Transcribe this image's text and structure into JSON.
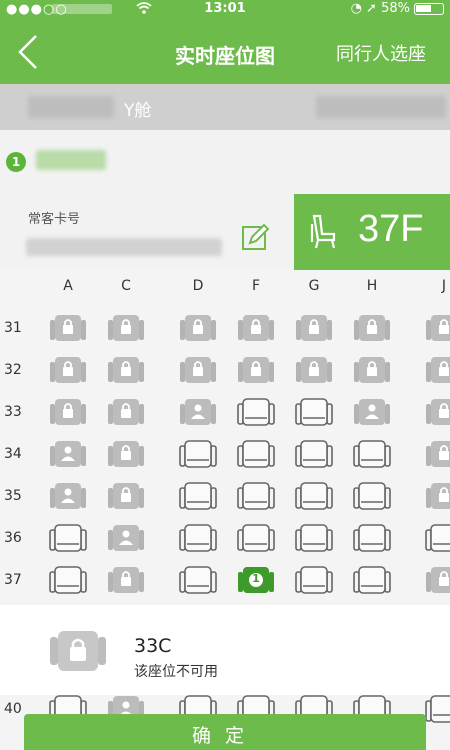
{
  "status_bar": {
    "time": "13:01",
    "battery": "58%"
  },
  "nav": {
    "title": "实时座位图",
    "companion_link": "同行人选座"
  },
  "cabin": {
    "label": "Y舱"
  },
  "passenger": {
    "index": "1",
    "ffp_label": "常客卡号",
    "selected_seat": "37F"
  },
  "columns": [
    "A",
    "C",
    "D",
    "F",
    "G",
    "H",
    "J"
  ],
  "rows": [
    {
      "num": "31",
      "seats": [
        "locked",
        "locked",
        "locked",
        "locked",
        "locked",
        "locked",
        "locked"
      ]
    },
    {
      "num": "32",
      "seats": [
        "locked",
        "locked",
        "locked",
        "locked",
        "locked",
        "locked",
        "locked"
      ]
    },
    {
      "num": "33",
      "seats": [
        "locked",
        "locked",
        "occupied",
        "available",
        "available",
        "occupied",
        "locked"
      ]
    },
    {
      "num": "34",
      "seats": [
        "occupied",
        "locked",
        "available",
        "available",
        "available",
        "available",
        "locked"
      ]
    },
    {
      "num": "35",
      "seats": [
        "occupied",
        "locked",
        "available",
        "available",
        "available",
        "available",
        "locked"
      ]
    },
    {
      "num": "36",
      "seats": [
        "available",
        "occupied",
        "available",
        "available",
        "available",
        "available",
        "available"
      ]
    },
    {
      "num": "37",
      "seats": [
        "available",
        "locked",
        "available",
        "selected",
        "available",
        "available",
        "locked"
      ]
    }
  ],
  "selected_marker": "1",
  "popup": {
    "seat": "33C",
    "message": "该座位不可用"
  },
  "bottom_row": {
    "num": "40"
  },
  "confirm_label": "确定",
  "colors": {
    "brand_green": "#6dbb4a",
    "selected_green": "#3d9a2b",
    "seat_grey": "#bcbcbc"
  }
}
